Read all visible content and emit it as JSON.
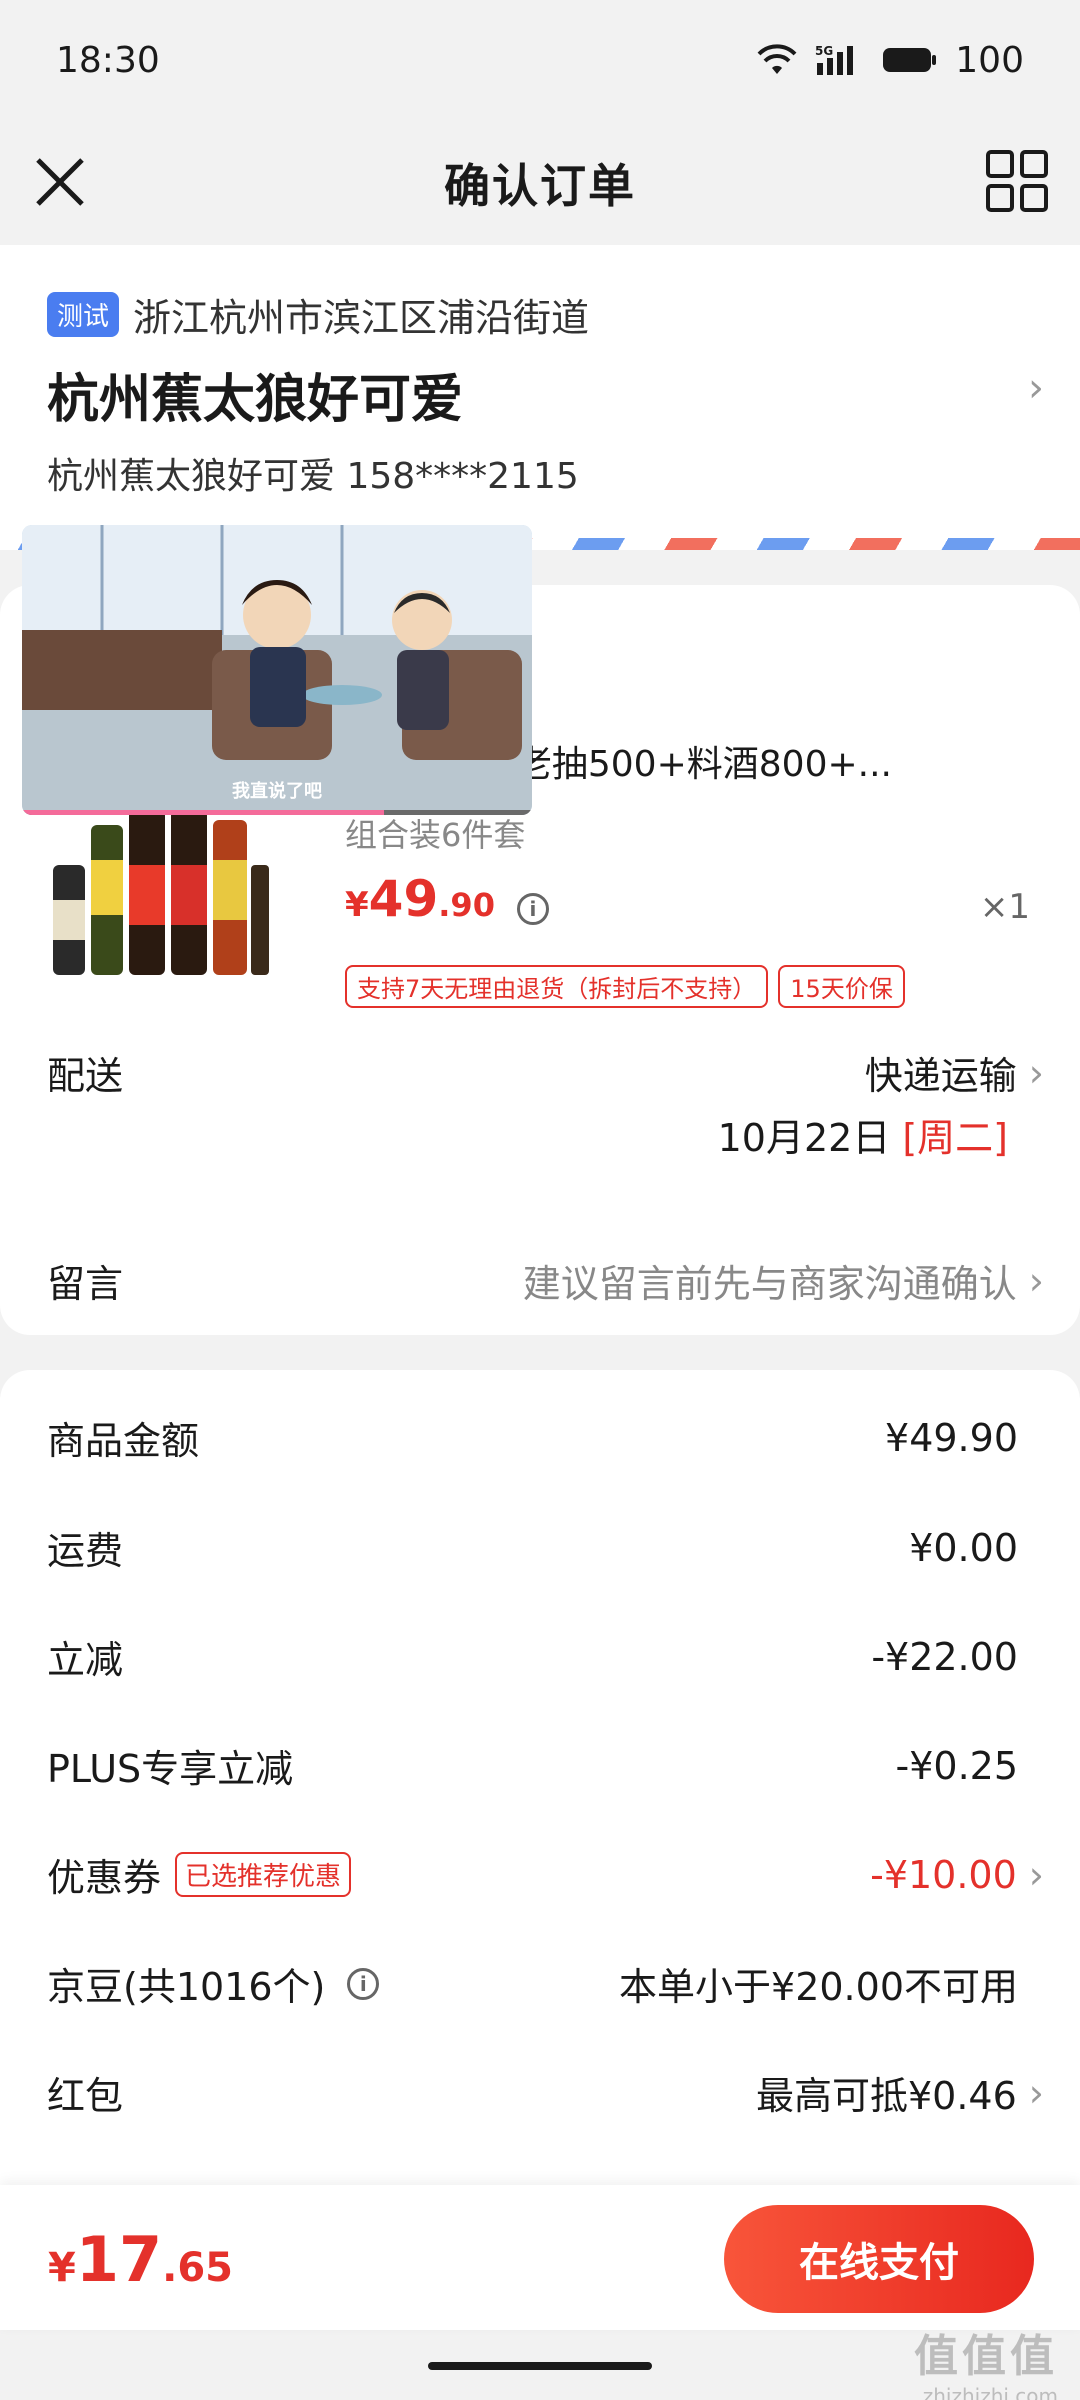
{
  "status_bar": {
    "time": "18:30",
    "network": "5G",
    "battery": "100"
  },
  "nav": {
    "title": "确认订单"
  },
  "address": {
    "tag": "测试",
    "region": "浙江杭州市滨江区浦沿街道",
    "name": "杭州蕉太狼好可爱",
    "contact": "杭州蕉太狼好可爱 158****2115"
  },
  "goods": {
    "title": "生抽500+老抽500+料酒800+...",
    "spec": "组合装6件套",
    "price_yen": "¥",
    "price_int": "49",
    "price_dec": ".90",
    "qty": "×1",
    "tags": [
      "支持7天无理由退货（拆封后不支持）",
      "15天价保"
    ]
  },
  "video": {
    "caption": "我直说了吧",
    "progress": 0.71
  },
  "delivery": {
    "label": "配送",
    "method": "快递运输",
    "date": "10月22日",
    "weekday": "[周二]"
  },
  "message": {
    "label": "留言",
    "placeholder": "建议留言前先与商家沟通确认"
  },
  "fees": {
    "goods_amount": {
      "label": "商品金额",
      "value": "¥49.90"
    },
    "shipping": {
      "label": "运费",
      "value": "¥0.00"
    },
    "instant_discount": {
      "label": "立减",
      "value": "-¥22.00"
    },
    "plus_discount": {
      "label": "PLUS专享立减",
      "value": "-¥0.25"
    },
    "coupon": {
      "label": "优惠券",
      "chip": "已选推荐优惠",
      "value": "-¥10.00"
    },
    "jd_beans": {
      "label": "京豆(共1016个)",
      "value": "本单小于¥20.00不可用"
    },
    "red_packet": {
      "label": "红包",
      "value": "最高可抵¥0.46"
    }
  },
  "bottom": {
    "total_yen": "¥",
    "total_int": "17",
    "total_dec": ".65",
    "pay_label": "在线支付"
  },
  "watermark": {
    "big": "值值值",
    "small": "zhizhizhi.com"
  },
  "colors": {
    "accent_red": "#e4312b",
    "tag_blue": "#4a7df0"
  }
}
